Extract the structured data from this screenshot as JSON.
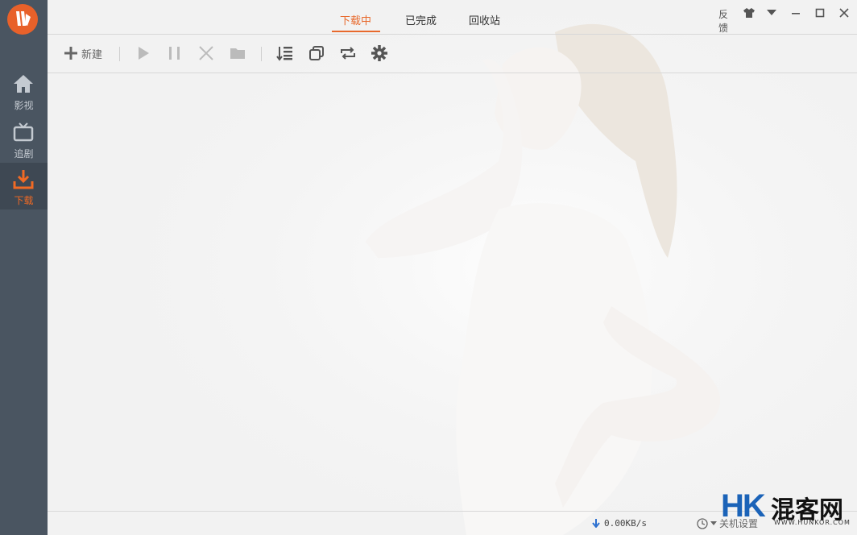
{
  "sidebar": {
    "items": [
      {
        "label": "影视",
        "icon": "home-icon"
      },
      {
        "label": "追剧",
        "icon": "tv-icon"
      },
      {
        "label": "下载",
        "icon": "download-icon",
        "active": true
      }
    ]
  },
  "tabs": [
    {
      "label": "下载中",
      "active": true
    },
    {
      "label": "已完成"
    },
    {
      "label": "回收站"
    }
  ],
  "window_controls": {
    "feedback_label": "反馈",
    "icons": [
      "skin-icon",
      "menu-dropdown-icon",
      "minimize-icon",
      "maximize-icon",
      "close-icon"
    ]
  },
  "toolbar": {
    "new_label": "新建",
    "icons": [
      "add-icon",
      "play-icon",
      "pause-icon",
      "delete-icon",
      "folder-icon",
      "list-icon",
      "copy-icon",
      "repeat-icon",
      "settings-icon"
    ]
  },
  "status": {
    "speed": "0.00KB/s",
    "shutdown_label": "关机设置"
  },
  "watermark": {
    "logo": "HK",
    "name": "混客网",
    "url": "WWW.HUNKOR.COM"
  },
  "colors": {
    "accent": "#e8692c",
    "sidebar": "#4a5561",
    "watermark_blue": "#1b63b8"
  }
}
